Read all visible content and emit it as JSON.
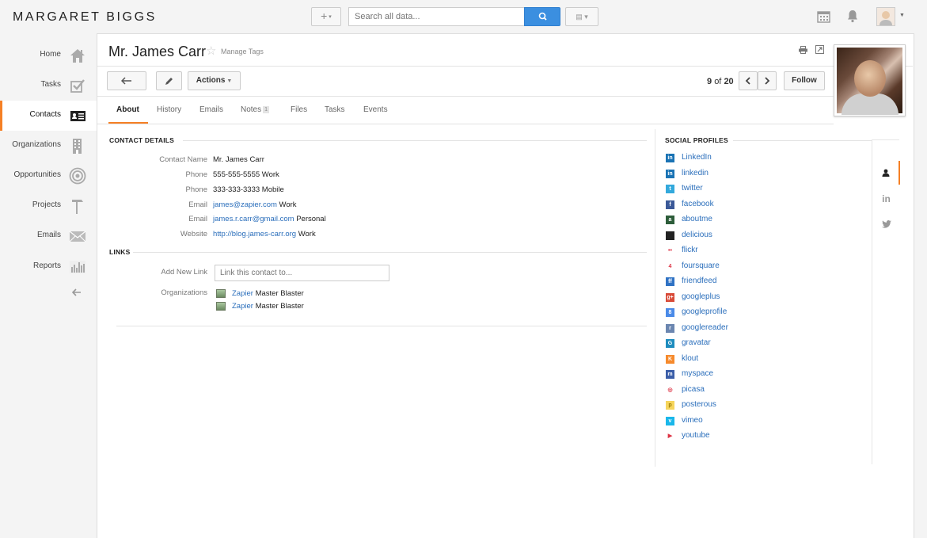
{
  "brand": "MARGARET BIGGS",
  "search": {
    "placeholder": "Search all data..."
  },
  "sidebar": {
    "items": [
      {
        "label": "Home"
      },
      {
        "label": "Tasks"
      },
      {
        "label": "Contacts"
      },
      {
        "label": "Organizations"
      },
      {
        "label": "Opportunities"
      },
      {
        "label": "Projects"
      },
      {
        "label": "Emails"
      },
      {
        "label": "Reports"
      }
    ]
  },
  "contact": {
    "name": "Mr. James Carr",
    "manage_tags": "Manage Tags"
  },
  "toolbar": {
    "actions": "Actions",
    "pager_current": "9",
    "pager_of": "of",
    "pager_total": "20",
    "follow": "Follow"
  },
  "tabs": [
    {
      "label": "About"
    },
    {
      "label": "History"
    },
    {
      "label": "Emails"
    },
    {
      "label": "Notes",
      "badge": "1"
    },
    {
      "label": "Files"
    },
    {
      "label": "Tasks"
    },
    {
      "label": "Events"
    }
  ],
  "details": {
    "heading": "CONTACT DETAILS",
    "rows": [
      {
        "key": "Contact Name",
        "value": "Mr. James Carr",
        "suffix": ""
      },
      {
        "key": "Phone",
        "value": "555-555-5555",
        "suffix": " Work"
      },
      {
        "key": "Phone",
        "value": "333-333-3333",
        "suffix": " Mobile"
      },
      {
        "key": "Email",
        "value": "james@zapier.com",
        "suffix": " Work"
      },
      {
        "key": "Email",
        "value": "james.r.carr@gmail.com",
        "suffix": " Personal"
      },
      {
        "key": "Website",
        "value": "http://blog.james-carr.org",
        "suffix": " Work"
      }
    ]
  },
  "links": {
    "heading": "LINKS",
    "add_label": "Add New Link",
    "add_placeholder": "Link this contact to...",
    "org_label": "Organizations",
    "orgs": [
      {
        "link": "Zapier",
        "rest": " Master Blaster"
      },
      {
        "link": "Zapier",
        "rest": " Master Blaster"
      }
    ]
  },
  "social": {
    "heading": "SOCIAL PROFILES",
    "items": [
      {
        "label": "LinkedIn",
        "color": "#1a73b4",
        "glyph": "in"
      },
      {
        "label": "linkedin",
        "color": "#1a73b4",
        "glyph": "in"
      },
      {
        "label": "twitter",
        "color": "#33a9dc",
        "glyph": "t"
      },
      {
        "label": "facebook",
        "color": "#3b5998",
        "glyph": "f"
      },
      {
        "label": "aboutme",
        "color": "#2d5d3a",
        "glyph": "a"
      },
      {
        "label": "delicious",
        "color": "#222222",
        "glyph": ""
      },
      {
        "label": "flickr",
        "color": "#ffffff",
        "glyph": "••"
      },
      {
        "label": "foursquare",
        "color": "#ffffff",
        "glyph": "4"
      },
      {
        "label": "friendfeed",
        "color": "#2f72c4",
        "glyph": "ff"
      },
      {
        "label": "googleplus",
        "color": "#d84a38",
        "glyph": "g+"
      },
      {
        "label": "googleprofile",
        "color": "#4a8ae8",
        "glyph": "8"
      },
      {
        "label": "googlereader",
        "color": "#6b86b0",
        "glyph": "r"
      },
      {
        "label": "gravatar",
        "color": "#1e8cbe",
        "glyph": "G"
      },
      {
        "label": "klout",
        "color": "#f68a2c",
        "glyph": "K"
      },
      {
        "label": "myspace",
        "color": "#3b5ea8",
        "glyph": "m"
      },
      {
        "label": "picasa",
        "color": "#ffffff",
        "glyph": "◎"
      },
      {
        "label": "posterous",
        "color": "#f6d55c",
        "glyph": "p"
      },
      {
        "label": "vimeo",
        "color": "#1ab7ea",
        "glyph": "v"
      },
      {
        "label": "youtube",
        "color": "#ffffff",
        "glyph": "▶"
      }
    ]
  }
}
